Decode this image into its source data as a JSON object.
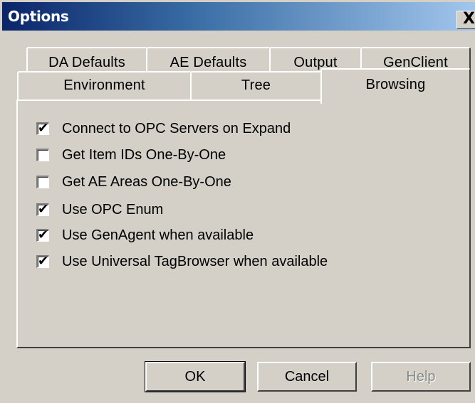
{
  "window": {
    "title": "Options",
    "close_glyph": "X"
  },
  "tabs": {
    "row1": [
      {
        "label": "DA Defaults"
      },
      {
        "label": "AE Defaults"
      },
      {
        "label": "Output"
      },
      {
        "label": "GenClient"
      }
    ],
    "row2": [
      {
        "label": "Environment"
      },
      {
        "label": "Tree"
      },
      {
        "label": "Browsing",
        "active": true
      }
    ]
  },
  "options": [
    {
      "label": "Connect to OPC Servers on Expand",
      "checked": true
    },
    {
      "label": "Get Item IDs One-By-One",
      "checked": false
    },
    {
      "label": "Get AE Areas One-By-One",
      "checked": false
    },
    {
      "label": "Use OPC Enum",
      "checked": true
    },
    {
      "label": "Use GenAgent when available",
      "checked": true
    },
    {
      "label": "Use Universal TagBrowser when available",
      "checked": true
    }
  ],
  "buttons": {
    "ok": "OK",
    "cancel": "Cancel",
    "help": "Help"
  },
  "icons": {
    "close": "close-icon",
    "check": "check-icon"
  },
  "colors": {
    "face": "#d4d0c8",
    "title_start": "#0a246a",
    "title_end": "#a6caf0",
    "disabled_text": "#8a8a8a"
  }
}
